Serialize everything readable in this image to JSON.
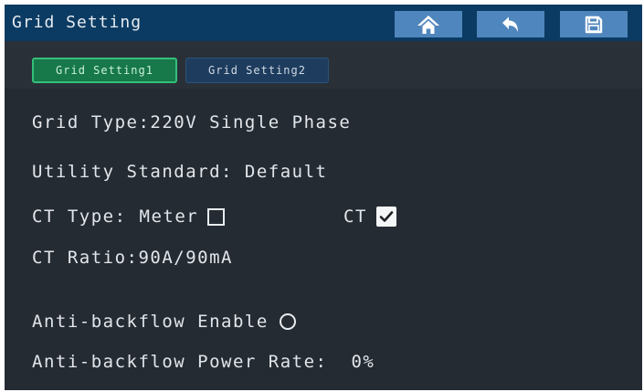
{
  "header": {
    "title": "Grid Setting",
    "buttons": [
      {
        "icon": "home-icon"
      },
      {
        "icon": "back-arrow-icon"
      },
      {
        "icon": "save-icon"
      }
    ],
    "background_color": "#0b3b63",
    "button_color": "#4f86bd"
  },
  "tabs": [
    {
      "label": "Grid Setting1",
      "active": true
    },
    {
      "label": "Grid Setting2",
      "active": false
    }
  ],
  "settings": {
    "grid_type": {
      "label": "Grid Type:",
      "value": "220V Single Phase"
    },
    "utility_standard": {
      "label": "Utility Standard:",
      "value": " Default"
    },
    "ct_type": {
      "label": "CT Type:",
      "options": [
        {
          "label": "Meter",
          "checked": false
        },
        {
          "label": "CT",
          "checked": true
        }
      ]
    },
    "ct_ratio": {
      "label": "CT Ratio:",
      "value": "90A/90mA"
    },
    "anti_backflow_enable": {
      "label": "Anti-backflow Enable",
      "enabled": false
    },
    "anti_backflow_power_rate": {
      "label": "Anti-backflow Power Rate:",
      "value": "0%"
    }
  },
  "colors": {
    "screen_background": "#252b33",
    "active_tab": "#17784a",
    "inactive_tab": "#1e3c5e",
    "text": "#e2e6ea"
  }
}
